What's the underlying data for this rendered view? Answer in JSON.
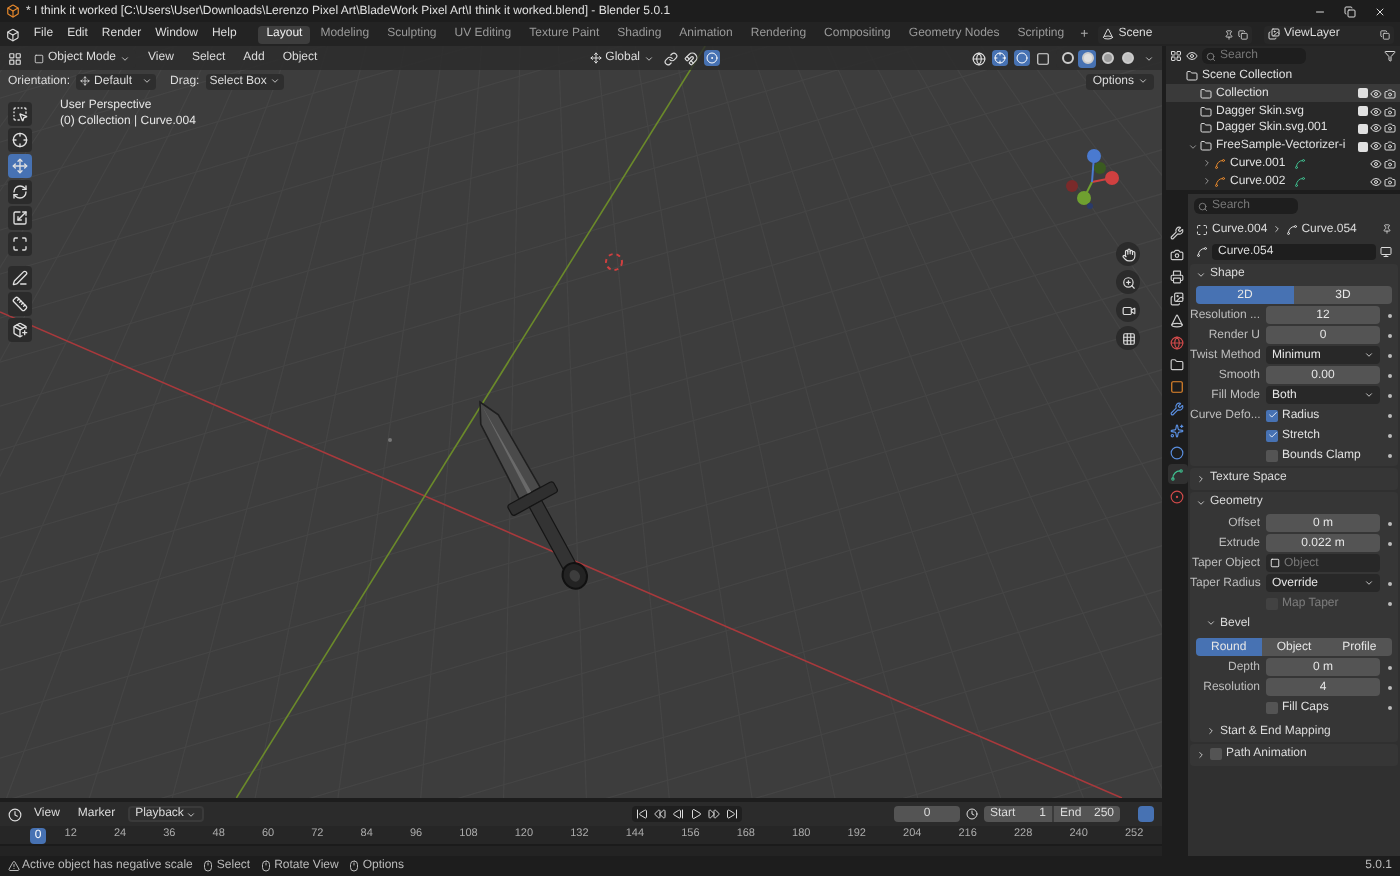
{
  "window": {
    "title": "* I think it worked [C:\\Users\\User\\Downloads\\Lerenzo Pixel Art\\BladeWork Pixel Art\\I think it worked.blend] - Blender 5.0.1"
  },
  "menu": [
    "File",
    "Edit",
    "Render",
    "Window",
    "Help"
  ],
  "workspaces": [
    {
      "label": "Layout",
      "selected": true
    },
    {
      "label": "Modeling",
      "selected": false
    },
    {
      "label": "Sculpting",
      "selected": false
    },
    {
      "label": "UV Editing",
      "selected": false
    },
    {
      "label": "Texture Paint",
      "selected": false
    },
    {
      "label": "Shading",
      "selected": false
    },
    {
      "label": "Animation",
      "selected": false
    },
    {
      "label": "Rendering",
      "selected": false
    },
    {
      "label": "Compositing",
      "selected": false
    },
    {
      "label": "Geometry Nodes",
      "selected": false
    },
    {
      "label": "Scripting",
      "selected": false
    }
  ],
  "add_workspace": "+",
  "scene": "Scene",
  "view_layer": "ViewLayer",
  "viewport": {
    "mode": "Object Mode",
    "menus": [
      "View",
      "Select",
      "Add",
      "Object"
    ],
    "transform": "Global",
    "shading_modes": [
      {
        "kind": "wireframe",
        "selected": false
      },
      {
        "kind": "solid",
        "selected": true
      },
      {
        "kind": "material",
        "selected": false
      },
      {
        "kind": "rendered",
        "selected": false
      }
    ],
    "orientation_label": "Orientation:",
    "orientation": "Default",
    "drag_label": "Drag:",
    "drag": "Select Box",
    "options": "Options",
    "overlay_lines": [
      "User Perspective",
      "(0) Collection | Curve.004"
    ]
  },
  "tools": [
    {
      "kind": "select",
      "selected": false
    },
    {
      "kind": "cursor",
      "selected": false
    },
    {
      "kind": "move",
      "selected": true
    },
    {
      "kind": "rotate",
      "selected": false
    },
    {
      "kind": "scale",
      "selected": false
    },
    {
      "kind": "transform",
      "selected": false
    },
    {
      "kind": "annotate",
      "selected": false
    },
    {
      "kind": "measure",
      "selected": false
    },
    {
      "kind": "add_cube",
      "selected": false
    }
  ],
  "outliner": {
    "search_placeholder": "Search",
    "tree": [
      {
        "label": "Scene Collection",
        "kind": "scene",
        "children": [
          {
            "label": "Collection",
            "kind": "collection",
            "selected": true
          },
          {
            "label": "Dagger Skin.svg",
            "kind": "collection",
            "selected": false
          },
          {
            "label": "Dagger Skin.svg.001",
            "kind": "collection",
            "selected": false
          },
          {
            "label": "FreeSample-Vectorizer-i",
            "kind": "collection",
            "selected": false,
            "expanded": true,
            "children": [
              {
                "label": "Curve.001",
                "kind": "curve",
                "selected": false,
                "expanded": false
              },
              {
                "label": "Curve.002",
                "kind": "curve",
                "selected": false,
                "expanded": false
              }
            ]
          }
        ]
      }
    ]
  },
  "properties": {
    "search_placeholder": "Search",
    "tabs": [
      {
        "kind": "tool",
        "selected": false
      },
      {
        "kind": "render",
        "selected": false
      },
      {
        "kind": "output",
        "selected": false
      },
      {
        "kind": "view_layer",
        "selected": false
      },
      {
        "kind": "scene",
        "selected": false
      },
      {
        "kind": "world",
        "selected": false
      },
      {
        "kind": "collection",
        "selected": false
      },
      {
        "kind": "object",
        "selected": false
      },
      {
        "kind": "modifiers",
        "selected": false
      },
      {
        "kind": "particles",
        "selected": false
      },
      {
        "kind": "physics",
        "selected": false
      },
      {
        "kind": "data",
        "selected": true
      },
      {
        "kind": "material",
        "selected": false
      }
    ],
    "breadcrumb": [
      "Curve.004",
      "Curve.054"
    ],
    "datablock": "Curve.054",
    "panels": [
      {
        "title": "Shape",
        "expanded": true,
        "rows": [
          {
            "kind": "toggle",
            "options": [
              {
                "label": "2D",
                "selected": true
              },
              {
                "label": "3D",
                "selected": false
              }
            ]
          },
          {
            "kind": "number",
            "label": "Resolution ...",
            "value": "12"
          },
          {
            "kind": "number",
            "label": "Render U",
            "value": "0"
          },
          {
            "kind": "dropdown",
            "label": "Twist Method",
            "value": "Minimum"
          },
          {
            "kind": "number",
            "label": "Smooth",
            "value": "0.00"
          },
          {
            "kind": "dropdown",
            "label": "Fill Mode",
            "value": "Both"
          },
          {
            "kind": "checkbox",
            "label": "Curve Defo...",
            "text": "Radius",
            "checked": true,
            "disabled": false
          },
          {
            "kind": "checkbox",
            "text": "Stretch",
            "checked": true,
            "disabled": false
          },
          {
            "kind": "checkbox",
            "text": "Bounds Clamp",
            "checked": false,
            "disabled": false
          }
        ]
      },
      {
        "title": "Texture Space",
        "expanded": false
      },
      {
        "title": "Geometry",
        "expanded": true,
        "rows": [
          {
            "kind": "number",
            "label": "Offset",
            "value": "0 m"
          },
          {
            "kind": "number",
            "label": "Extrude",
            "value": "0.022 m"
          },
          {
            "kind": "object",
            "label": "Taper Object",
            "placeholder": "Object"
          },
          {
            "kind": "dropdown",
            "label": "Taper Radius",
            "value": "Override"
          },
          {
            "kind": "checkbox",
            "text": "Map Taper",
            "checked": false,
            "disabled": true
          },
          {
            "kind": "subpanel",
            "title": "Bevel",
            "expanded": true,
            "rows": [
              {
                "kind": "toggle",
                "options": [
                  {
                    "label": "Round",
                    "selected": true
                  },
                  {
                    "label": "Object",
                    "selected": false
                  },
                  {
                    "label": "Profile",
                    "selected": false
                  }
                ]
              },
              {
                "kind": "number",
                "label": "Depth",
                "value": "0 m"
              },
              {
                "kind": "number",
                "label": "Resolution",
                "value": "4"
              },
              {
                "kind": "checkbox",
                "text": "Fill Caps",
                "checked": false,
                "disabled": false
              }
            ]
          },
          {
            "kind": "subpanel",
            "title": "Start & End Mapping",
            "expanded": false
          }
        ]
      },
      {
        "title": "Path Animation",
        "expanded": false,
        "checkbox": false
      }
    ]
  },
  "timeline": {
    "menus": [
      {
        "label": "View",
        "kind": "menu"
      },
      {
        "label": "Marker",
        "kind": "menu"
      },
      {
        "label": "Playback",
        "kind": "dropdown"
      }
    ],
    "current_frame": "0",
    "start_label": "Start",
    "start": "1",
    "end_label": "End",
    "end": "250",
    "playhead": "0",
    "ruler": [
      "12",
      "24",
      "36",
      "48",
      "60",
      "72",
      "84",
      "96",
      "108",
      "120",
      "132",
      "144",
      "156",
      "168",
      "180",
      "192",
      "204",
      "216",
      "228",
      "240",
      "252"
    ]
  },
  "status_bar": {
    "items": [
      {
        "kind": "warning",
        "label": "Active object has negative scale"
      },
      {
        "kind": "mouse_left",
        "label": "Select"
      },
      {
        "kind": "mouse_middle",
        "label": "Rotate View"
      },
      {
        "kind": "mouse_right",
        "label": "Options"
      }
    ],
    "version": "5.0.1"
  }
}
